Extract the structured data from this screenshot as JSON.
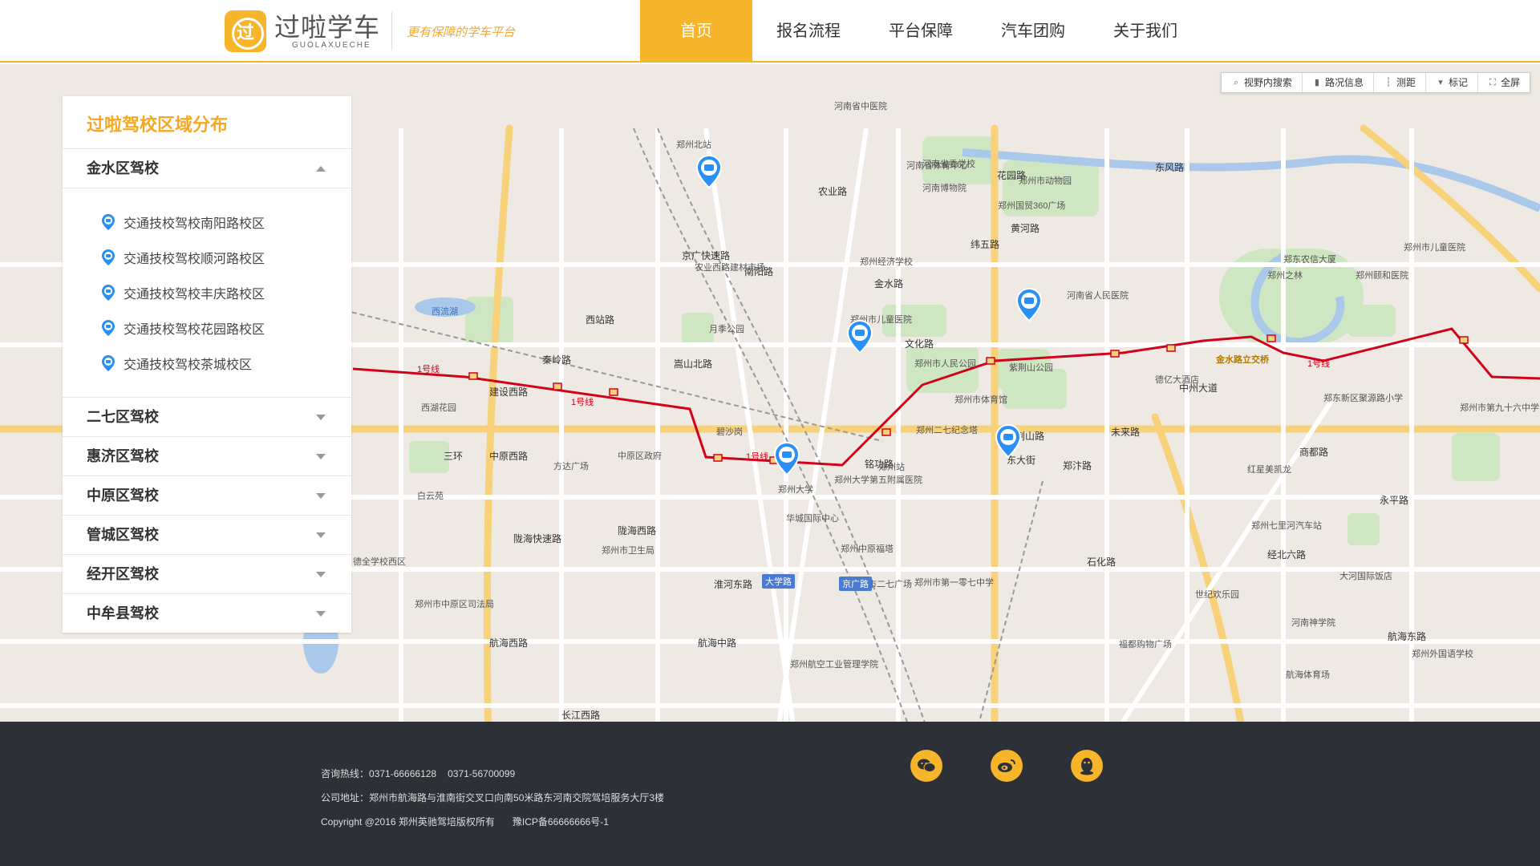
{
  "brand": {
    "name": "过啦学车",
    "name_en": "GUOLAXUECHE",
    "slogan": "更有保障的学车平台",
    "accent": "#f7b52c"
  },
  "nav": [
    {
      "label": "首页",
      "active": true
    },
    {
      "label": "报名流程",
      "active": false
    },
    {
      "label": "平台保障",
      "active": false
    },
    {
      "label": "汽车团购",
      "active": false
    },
    {
      "label": "关于我们",
      "active": false
    }
  ],
  "map_toolbar": [
    {
      "icon": "search-icon",
      "label": "视野内搜索"
    },
    {
      "icon": "traffic-light-icon",
      "label": "路况信息"
    },
    {
      "icon": "ruler-icon",
      "label": "测距"
    },
    {
      "icon": "flag-icon",
      "label": "标记"
    },
    {
      "icon": "fullscreen-icon",
      "label": "全屏"
    }
  ],
  "panel": {
    "title": "过啦驾校区域分布",
    "districts": [
      {
        "name": "金水区驾校",
        "expanded": true,
        "campuses": [
          "交通技校驾校南阳路校区",
          "交通技校驾校顺河路校区",
          "交通技校驾校丰庆路校区",
          "交通技校驾校花园路校区",
          "交通技校驾校茶城校区"
        ]
      },
      {
        "name": "二七区驾校",
        "expanded": false
      },
      {
        "name": "惠济区驾校",
        "expanded": false
      },
      {
        "name": "中原区驾校",
        "expanded": false
      },
      {
        "name": "管城区驾校",
        "expanded": false
      },
      {
        "name": "经开区驾校",
        "expanded": false
      },
      {
        "name": "中牟县驾校",
        "expanded": false
      }
    ]
  },
  "map_labels": {
    "roads": [
      "金水路",
      "黄河路",
      "农业路",
      "纬五路",
      "东风路",
      "建设西路",
      "中原西路",
      "陇海快速路",
      "陇海西路",
      "航海中路",
      "航海西路",
      "淮河东路",
      "石化路",
      "东大街",
      "郑汴路",
      "商都路",
      "永平路",
      "经北六路",
      "航海东路",
      "长江西路",
      "西站路",
      "秦岭路",
      "三环",
      "京广快速路",
      "南阳路",
      "花园路",
      "未来路",
      "中州大道",
      "文化路",
      "铭功路",
      "嵩山北路",
      "紫荆山路"
    ],
    "places": [
      "郑州市儿童医院",
      "郑州市人民公园",
      "郑州市体育馆",
      "郑州二七纪念塔",
      "郑州大学第五附属医院",
      "郑州大学",
      "郑州站",
      "华城国际中心",
      "中原区政府",
      "方达广场",
      "碧沙岗",
      "西流湖",
      "月季公园",
      "郑州北站",
      "河南省中医院",
      "郑州市动物园",
      "郑州国贸360广场",
      "河南省人民医院",
      "紫荆山公园",
      "德亿大酒店",
      "红星美凯龙",
      "郑州市卫生局",
      "郑州中原福塔",
      "郑州市二七广场",
      "郑东新区聚源路小学",
      "郑州市第九十六中学",
      "河南省体育中心",
      "郑州市儿童医院",
      "金水路立交桥",
      "郑州七里河汽车站",
      "大河国际饭店",
      "郑州市第一零七中学",
      "郑州航空工业管理学院",
      "河南神学院",
      "福都购物广场",
      "航海体育场",
      "郑州外国语学校",
      "世纪欢乐园",
      "白云苑",
      "西湖花园",
      "德全学校西区",
      "郑州市中原区司法局",
      "郑州经济学校",
      "农业西路建材市场",
      "河南省委党校",
      "河南博物院",
      "郑州之林",
      "郑东农信大厦",
      "郑州颐和医院"
    ],
    "metro": [
      "1号线"
    ],
    "tags": [
      "大学路",
      "京广路"
    ]
  },
  "footer": {
    "hotline_label": "咨询热线：",
    "hotline_1": "0371-66666128",
    "hotline_2": "0371-56700099",
    "address_label": "公司地址：",
    "address": "郑州市航海路与淮南街交叉口向南50米路东河南交院驾培服务大厅3楼",
    "copyright": "Copyright @2016 郑州英驰驾培版权所有",
    "icp": "豫ICP备66666666号-1",
    "socials": [
      "wechat-icon",
      "weibo-icon",
      "qq-icon"
    ]
  }
}
